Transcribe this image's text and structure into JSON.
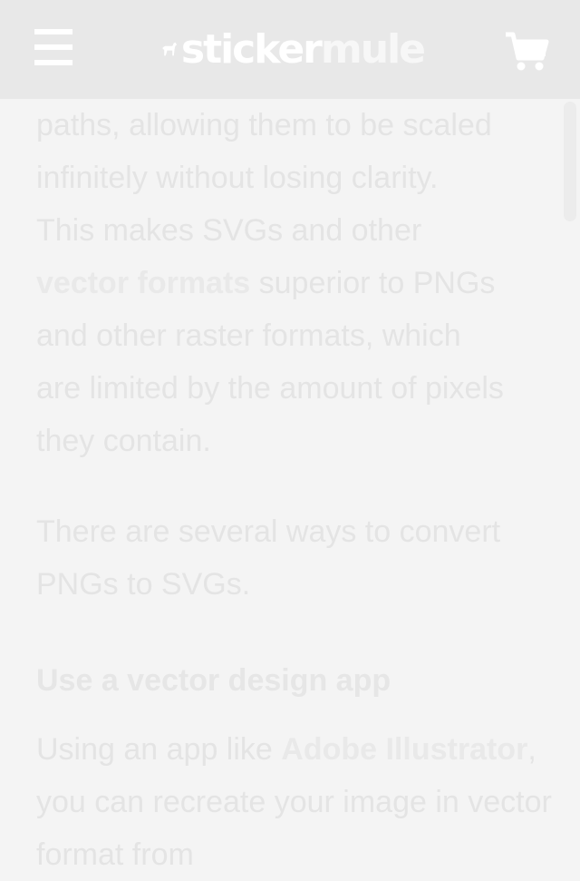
{
  "header": {
    "logo_part1": "sticker",
    "logo_part2": "mule",
    "menu_icon": "hamburger-menu-icon",
    "cart_icon": "shopping-cart-icon"
  },
  "article": {
    "para1": {
      "line1": "paths, allowing them to be scaled",
      "line2": "infinitely without losing clarity.",
      "line3": "This makes SVGs and other",
      "link": "vector formats",
      "line4_rest": " superior to PNGs",
      "line5": "and other raster formats, which",
      "line6": "are limited by the amount of pixels",
      "line7": "they contain."
    },
    "para2": "There are several ways to convert PNGs to SVGs.",
    "heading": "Use a vector design app",
    "para3": {
      "text1": "Using an app like ",
      "link": "Adobe Illustrator",
      "text2": ", you can recreate your image in vector format from"
    }
  },
  "colors": {
    "header_bg": "#e8e8e8",
    "page_bg": "#f4f4f4",
    "text": "#e4e4e4"
  }
}
